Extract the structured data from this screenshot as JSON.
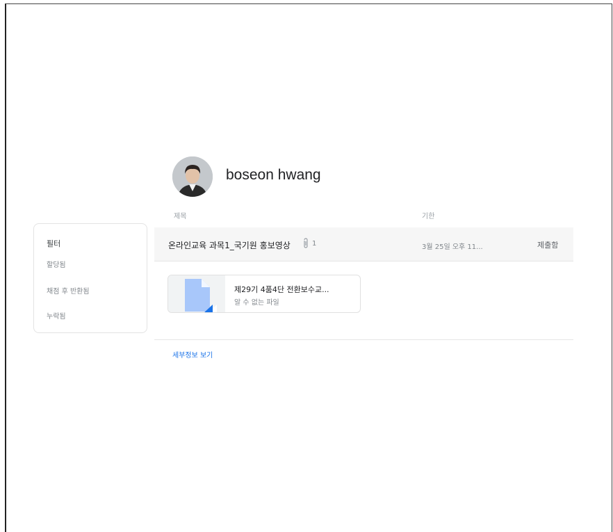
{
  "student": {
    "name": "boseon hwang"
  },
  "columns": {
    "title": "제목",
    "due": "기한"
  },
  "filters": {
    "title": "필터",
    "items": [
      "할당됨",
      "채점 후 반환됨",
      "누락됨"
    ]
  },
  "assignment": {
    "title": "온라인교육 과목1_국기원 홍보영상",
    "attachment_count": "1",
    "due": "3월 25일 오후 11...",
    "status": "제출함"
  },
  "file": {
    "name": "제29기 4품4단 전환보수교...",
    "type": "알 수 없는 파일"
  },
  "details_link": "세부정보 보기",
  "colors": {
    "accent": "#1a73e8",
    "row_bg": "#f6f6f6",
    "doc_blue": "#a8c7fa"
  },
  "icons": [
    "paperclip-icon",
    "document-icon"
  ]
}
